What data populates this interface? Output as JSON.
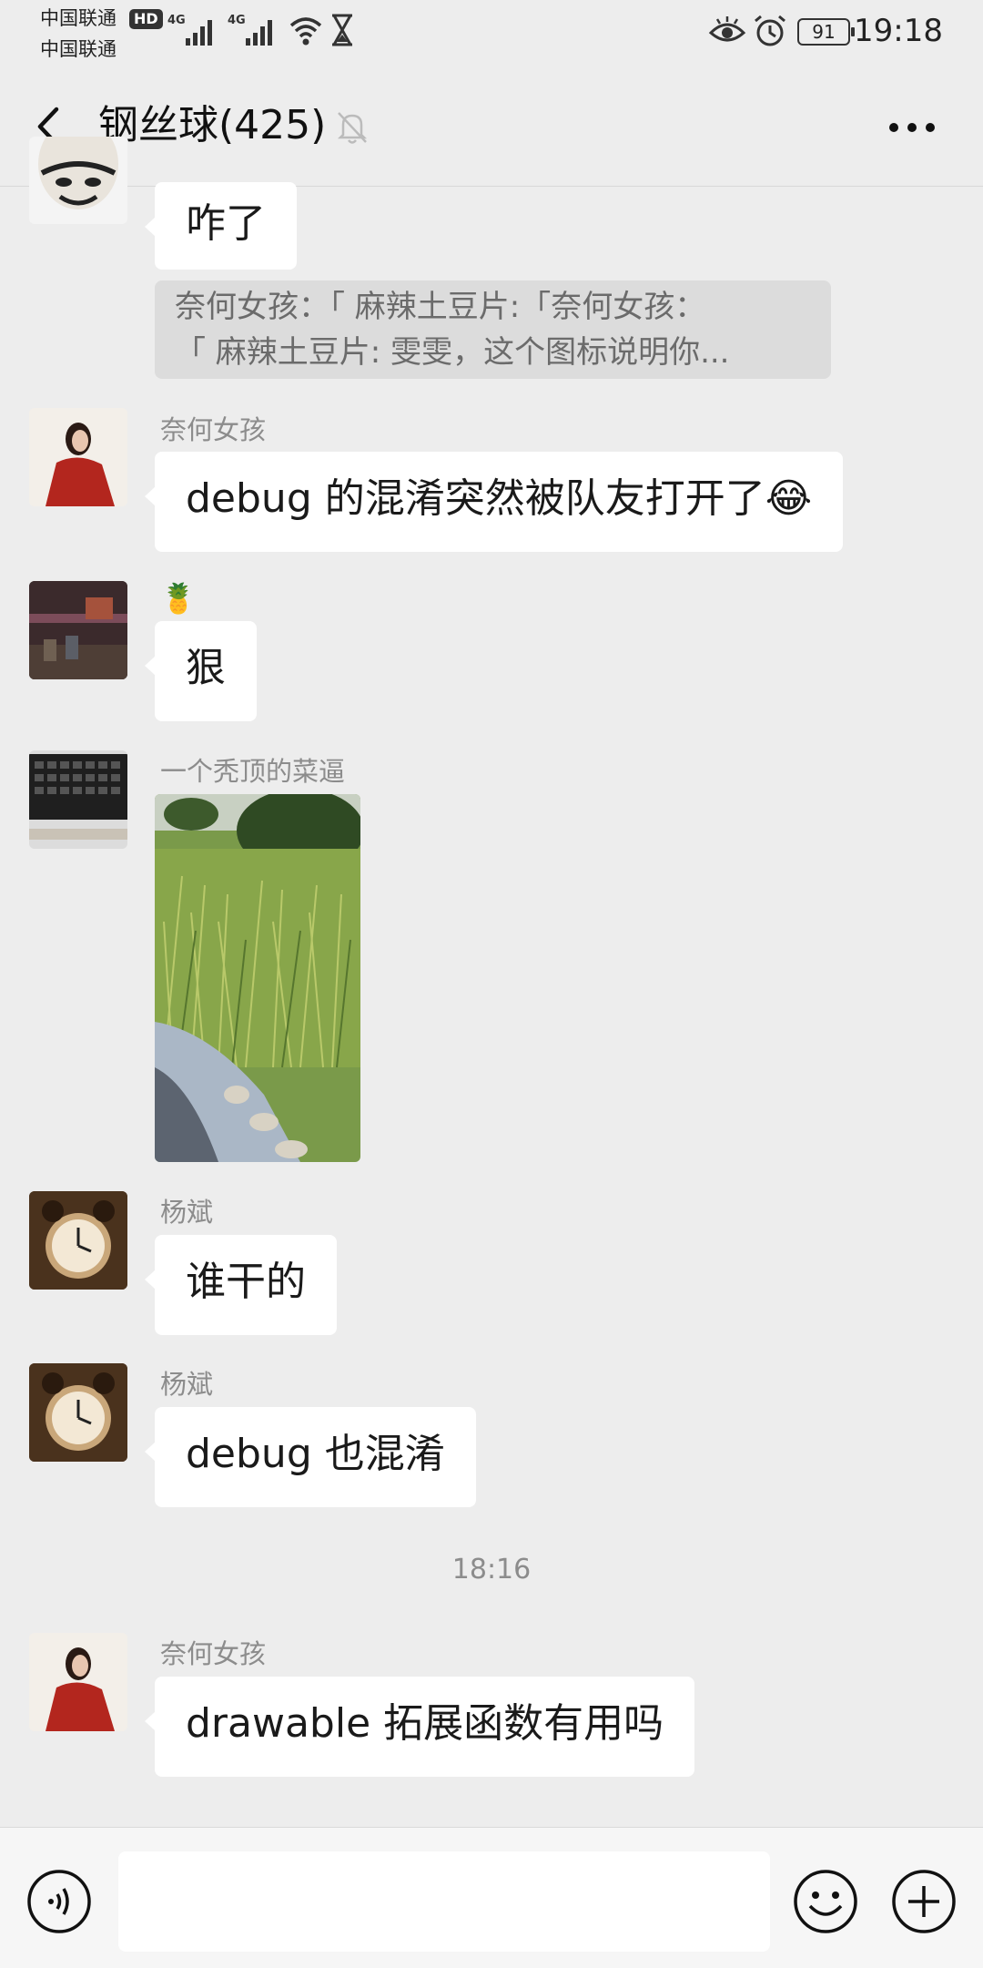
{
  "status_bar": {
    "carrier_1": "中国联通",
    "carrier_2": "中国联通",
    "hd_badge": "HD",
    "network_1": "4G",
    "network_2": "4G",
    "battery": "91",
    "time": "19:18"
  },
  "header": {
    "title": "钢丝球(425)"
  },
  "messages": [
    {
      "sender": "",
      "text": "咋了"
    },
    {
      "quote_line_1": "奈何女孩：「 麻辣土豆片:「奈何女孩：",
      "quote_line_2": "「 麻辣土豆片: 雯雯，这个图标说明你..."
    },
    {
      "sender": "奈何女孩",
      "text": "debug 的混淆突然被队友打开了",
      "emoji": "😂"
    },
    {
      "sender": "🍍",
      "text": "狠"
    },
    {
      "sender": "一个秃顶的菜逼",
      "type": "image"
    },
    {
      "sender": "杨斌",
      "text": "谁干的"
    },
    {
      "sender": "杨斌",
      "text": "debug 也混淆"
    },
    {
      "timestamp": "18:16"
    },
    {
      "sender": "奈何女孩",
      "text": "drawable 拓展函数有用吗"
    }
  ],
  "input_bar": {
    "placeholder": "",
    "value": ""
  },
  "colors": {
    "background": "#ededed",
    "bubble": "#ffffff",
    "meta_text": "#8c8c8c"
  }
}
